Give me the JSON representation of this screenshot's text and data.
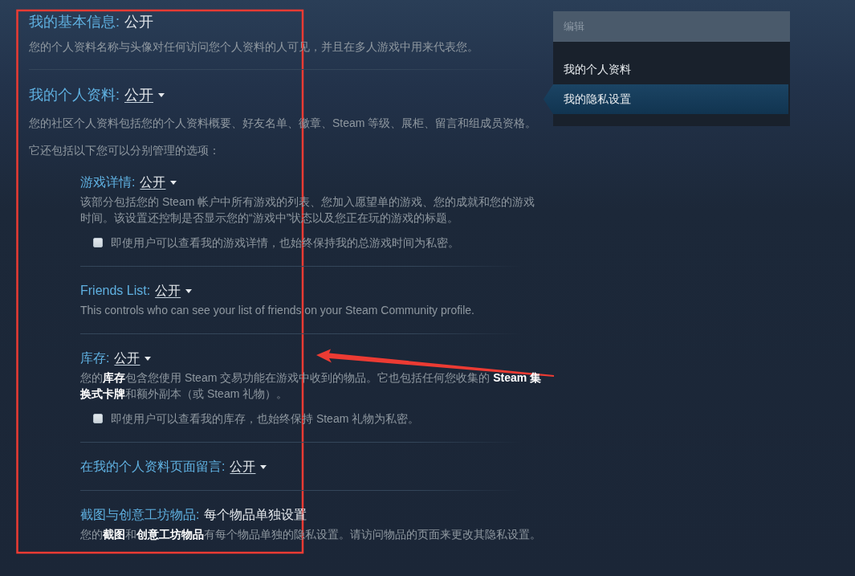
{
  "basic_info": {
    "label": "我的基本信息:",
    "value": "公开",
    "kind": "static",
    "description": "您的个人资料名称与头像对任何访问您个人资料的人可见，并且在多人游戏中用来代表您。"
  },
  "profile": {
    "label": "我的个人资料:",
    "value": "公开",
    "kind": "dropdown",
    "description": "您的社区个人资料包括您的个人资料概要、好友名单、徽章、Steam 等级、展柜、留言和组成员资格。",
    "note": "它还包括以下您可以分别管理的选项："
  },
  "profile_options": [
    {
      "label": "游戏详情:",
      "value": "公开",
      "kind": "dropdown",
      "description": "该部分包括您的 Steam 帐户中所有游戏的列表、您加入愿望单的游戏、您的成就和您的游戏时间。该设置还控制是否显示您的“游戏中”状态以及您正在玩的游戏的标题。",
      "checkbox": {
        "label": "即使用户可以查看我的游戏详情，也始终保持我的总游戏时间为私密。",
        "checked": false
      }
    },
    {
      "label": "Friends List:",
      "value": "公开",
      "kind": "dropdown",
      "description": "This controls who can see your list of friends on your Steam Community profile."
    },
    {
      "label": "库存:",
      "value": "公开",
      "kind": "dropdown",
      "description": "您的**库存**包含您使用 Steam 交易功能在游戏中收到的物品。它也包括任何您收集的 **Steam 集换式卡牌**和额外副本（或 Steam 礼物）。",
      "checkbox": {
        "label": "即使用户可以查看我的库存，也始终保持 Steam 礼物为私密。",
        "checked": false
      }
    },
    {
      "label": "在我的个人资料页面留言:",
      "value": "公开",
      "kind": "dropdown"
    },
    {
      "label": "截图与创意工坊物品:",
      "value": "每个物品单独设置",
      "kind": "static",
      "description": "您的**截图**和**创意工坊物品**有每个物品单独的隐私设置。请访问物品的页面来更改其隐私设置。"
    }
  ],
  "sidebar": {
    "header": "编辑",
    "items": [
      {
        "label": "我的个人资料",
        "selected": false
      },
      {
        "label": "我的隐私设置",
        "selected": true
      }
    ]
  }
}
